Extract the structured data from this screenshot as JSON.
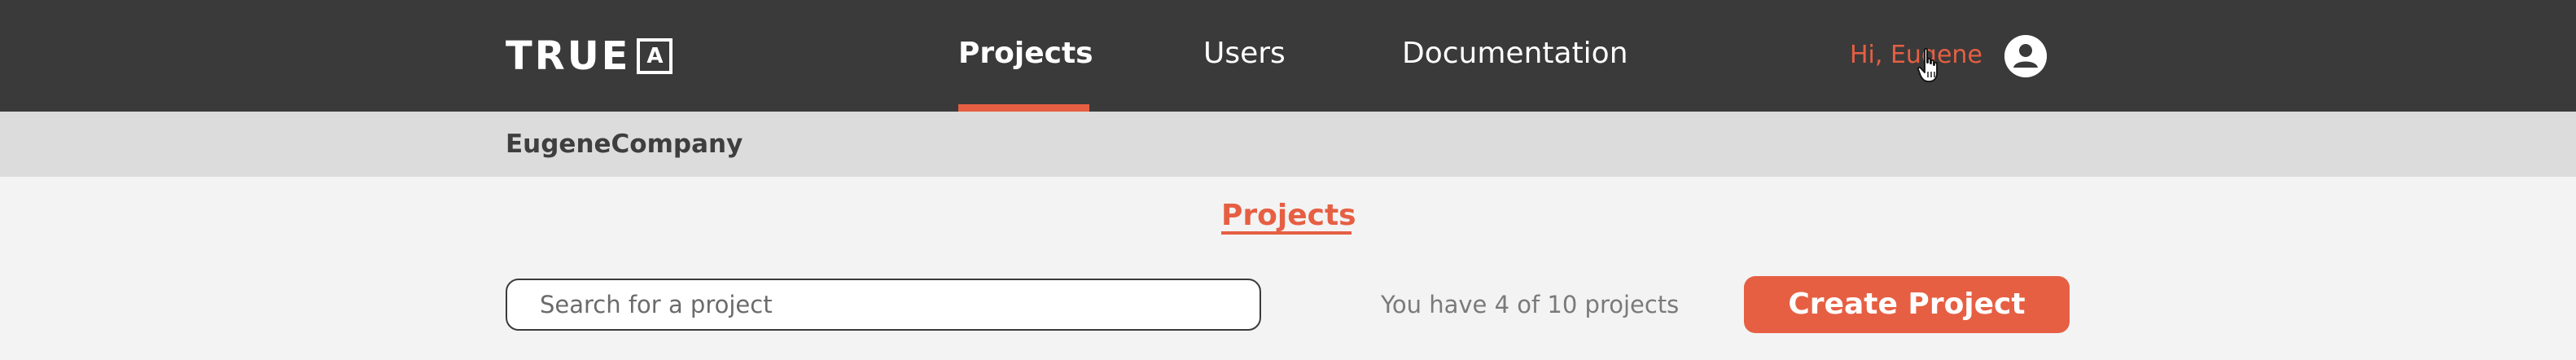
{
  "header": {
    "logo_text": "TRUE",
    "logo_mark": "A",
    "nav": [
      {
        "label": "Projects",
        "active": true
      },
      {
        "label": "Users",
        "active": false
      },
      {
        "label": "Documentation",
        "active": false
      }
    ],
    "greeting": "Hi, Eugene",
    "avatar_icon": "user-circle-icon",
    "cursor_icon": "hand-pointer-icon"
  },
  "company": {
    "name": "EugeneCompany"
  },
  "main": {
    "title": "Projects",
    "search_placeholder": "Search for a project",
    "search_value": "",
    "project_count_text": "You have 4 of 10 projects",
    "create_button_label": "Create Project"
  },
  "colors": {
    "header_bg": "#3a3a3a",
    "accent": "#e65f43",
    "company_bar_bg": "#dcdcdc",
    "page_bg": "#f3f3f3",
    "muted_text": "#7a7a7a"
  }
}
